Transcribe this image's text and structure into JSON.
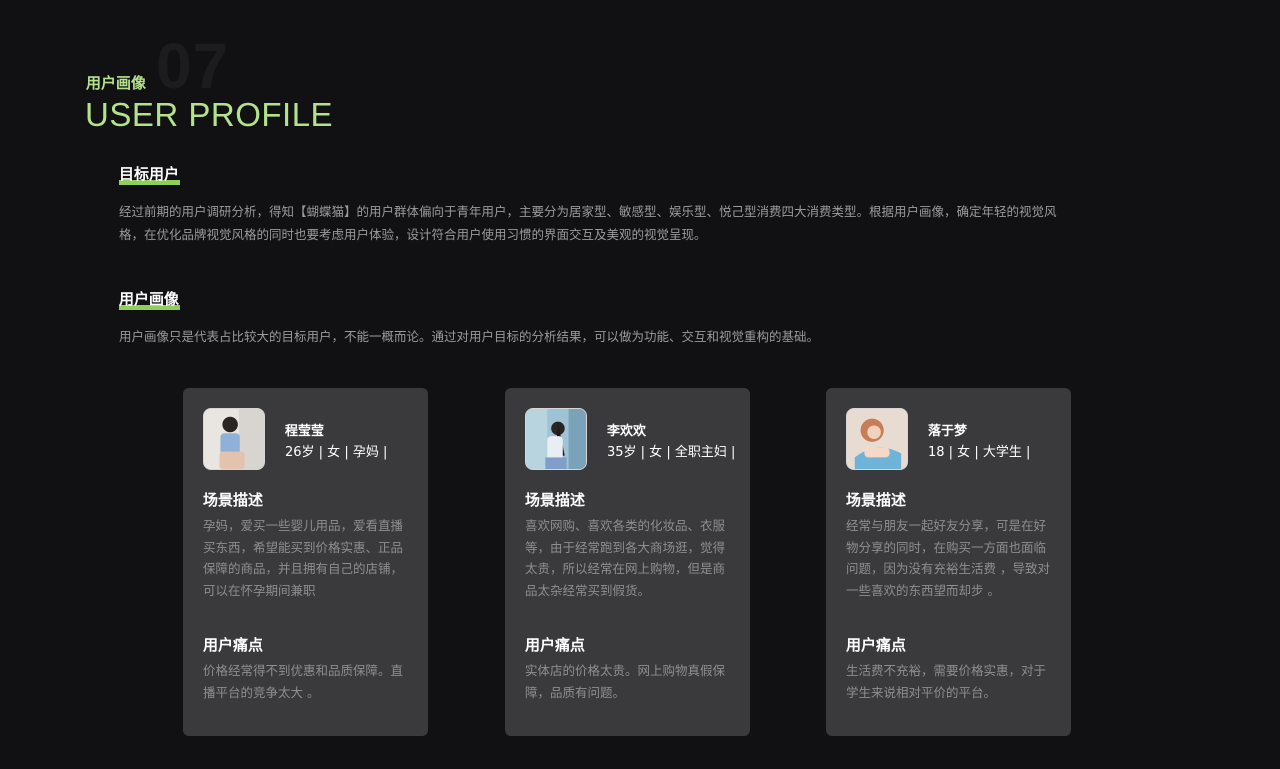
{
  "header": {
    "number": "07",
    "title_cn": "用户画像",
    "title_en": "USER PROFILE"
  },
  "target": {
    "heading": "目标用户",
    "text": "经过前期的用户调研分析，得知【蝴蝶猫】的用户群体偏向于青年用户，主要分为居家型、敏感型、娱乐型、悦己型消费四大消费类型。根据用户画像，确定年轻的视觉风格，在优化品牌视觉风格的同时也要考虑用户体验，设计符合用户使用习惯的界面交互及美观的视觉呈现。"
  },
  "persona": {
    "heading": "用户画像",
    "text": "用户画像只是代表占比较大的目标用户，不能一概而论。通过对用户目标的分析结果，可以做为功能、交互和视觉重构的基础。"
  },
  "cards": [
    {
      "name": "程莹莹",
      "meta": "26岁 | 女 | 孕妈 |",
      "scene_title": "场景描述",
      "scene_text": "孕妈，爱买一些婴儿用品，爱看直播买东西，希望能买到价格实惠、正品保障的商品，并且拥有自己的店铺，可以在怀孕期间兼职",
      "pain_title": "用户痛点",
      "pain_text": "价格经常得不到优惠和品质保障。直播平台的竞争太大 。"
    },
    {
      "name": "李欢欢",
      "meta": "35岁 | 女 | 全职主妇 |",
      "scene_title": "场景描述",
      "scene_text": "喜欢网购、喜欢各类的化妆品、衣服等，由于经常跑到各大商场逛，觉得太贵，所以经常在网上购物，但是商品太杂经常买到假货。",
      "pain_title": "用户痛点",
      "pain_text": "实体店的价格太贵。网上购物真假保障，品质有问题。"
    },
    {
      "name": "落于梦",
      "meta": "18 | 女 | 大学生 |",
      "scene_title": "场景描述",
      "scene_text": "经常与朋友一起好友分享，可是在好物分享的同时，在购买一方面也面临问题，因为没有充裕生活费 ，导致对一些喜欢的东西望而却步 。",
      "pain_title": "用户痛点",
      "pain_text": "生活费不充裕，需要价格实惠，对于学生来说相对平价的平台。"
    }
  ],
  "colors": {
    "background": "#111113",
    "accent": "#b3e28a",
    "card": "#3a3a3c"
  }
}
